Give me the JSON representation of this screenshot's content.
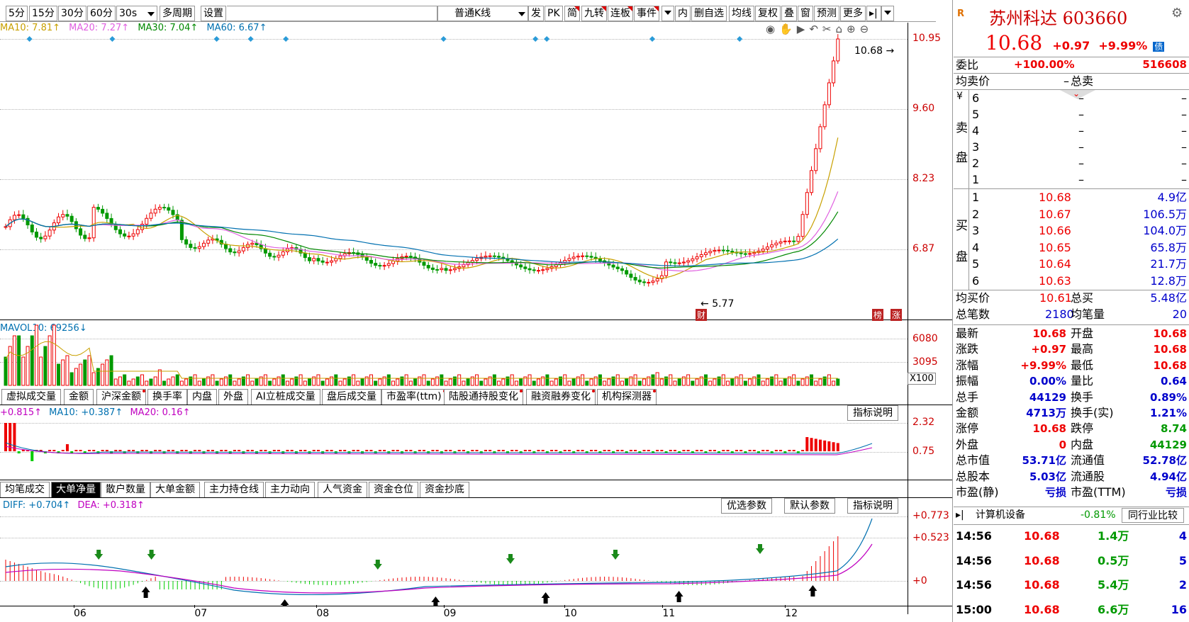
{
  "toolbar": {
    "periods": [
      "5分",
      "15分",
      "30分",
      "60分",
      "30s"
    ],
    "multi_period": "多周期",
    "settings": "设置",
    "kline_type": "普通K线",
    "tools": [
      "发",
      "PK",
      "简",
      "九转",
      "连板",
      "事件",
      "内",
      "删自选",
      "均线",
      "复权",
      "叠",
      "窗",
      "预测",
      "更多"
    ]
  },
  "ma_legend": [
    {
      "label": "MA10: 7.81↑",
      "color": "#c8a000"
    },
    {
      "label": "MA20: 7.27↑",
      "color": "#e060e0"
    },
    {
      "label": "MA30: 7.04↑",
      "color": "#008800"
    },
    {
      "label": "MA60: 6.67↑",
      "color": "#0070b0"
    }
  ],
  "price_axis": [
    "10.95",
    "9.60",
    "8.23",
    "6.87"
  ],
  "price_marker": "10.68",
  "low_marker": "5.77",
  "low_badge": "财",
  "badges": [
    "榜",
    "涨"
  ],
  "volume": {
    "legend": "MAVOL10: 69256↓",
    "axis": [
      "6080",
      "3095"
    ],
    "unit": "X100"
  },
  "vol_tabs": [
    {
      "label": "虚拟成交量",
      "flag": false
    },
    {
      "label": "金额",
      "flag": false
    },
    {
      "label": "沪深金额",
      "flag": true
    },
    {
      "label": "换手率",
      "flag": false
    },
    {
      "label": "内盘",
      "flag": false
    },
    {
      "label": "外盘",
      "flag": false
    },
    {
      "label": "AI立桩成交量",
      "flag": false
    },
    {
      "label": "盘后成交量",
      "flag": false
    },
    {
      "label": "市盈率(ttm)",
      "flag": true
    },
    {
      "label": "陆股通持股变化",
      "flag": true
    },
    {
      "label": "融资融券变化",
      "flag": true
    },
    {
      "label": "机构探测器",
      "flag": true
    }
  ],
  "ind1": {
    "legend": [
      {
        "label": "+0.815↑",
        "color": "#c000c0"
      },
      {
        "label": "MA10: +0.387↑",
        "color": "#0070b0"
      },
      {
        "label": "MA20: 0.16↑",
        "color": "#c000c0"
      }
    ],
    "axis": [
      "2.32",
      "0.75"
    ],
    "explain": "指标说明"
  },
  "ind1_tabs": [
    "均笔成交",
    "大单净量",
    "散户数量",
    "大单金额",
    "主力持仓线",
    "主力动向",
    "人气资金",
    "资金仓位",
    "资金抄底"
  ],
  "macd": {
    "diff": "DIFF: +0.704↑",
    "dea": "DEA: +0.318↑",
    "axis": [
      "+0.773",
      "+0.523",
      "+0"
    ],
    "buttons": [
      "优选参数",
      "默认参数",
      "指标说明"
    ]
  },
  "date_axis": [
    "06",
    "07",
    "08",
    "09",
    "10",
    "11",
    "12"
  ],
  "quote": {
    "name": "苏州科达",
    "code": "603660",
    "price": "10.68",
    "change": "+0.97",
    "pct": "+9.99%",
    "badge": "债",
    "r_badge": "R",
    "weibi_label": "委比",
    "weibi_value": "+100.00%",
    "weicha": "516608",
    "avg_sell_label": "均卖价",
    "avg_sell_value": "–",
    "total_sell_label": "总卖",
    "total_sell_value": "",
    "sell_side_label": [
      "卖",
      "盘"
    ],
    "sell_currency": "¥",
    "sells": [
      {
        "lvl": "6",
        "price": "–",
        "vol": "–"
      },
      {
        "lvl": "5",
        "price": "–",
        "vol": "–"
      },
      {
        "lvl": "4",
        "price": "–",
        "vol": "–"
      },
      {
        "lvl": "3",
        "price": "–",
        "vol": "–"
      },
      {
        "lvl": "2",
        "price": "–",
        "vol": "–"
      },
      {
        "lvl": "1",
        "price": "–",
        "vol": "–"
      }
    ],
    "buy_side_label": [
      "买",
      "盘"
    ],
    "buys": [
      {
        "lvl": "1",
        "price": "10.68",
        "vol": "4.9亿"
      },
      {
        "lvl": "2",
        "price": "10.67",
        "vol": "106.5万"
      },
      {
        "lvl": "3",
        "price": "10.66",
        "vol": "104.0万"
      },
      {
        "lvl": "4",
        "price": "10.65",
        "vol": "65.8万"
      },
      {
        "lvl": "5",
        "price": "10.64",
        "vol": "21.7万"
      },
      {
        "lvl": "6",
        "price": "10.63",
        "vol": "12.8万"
      }
    ],
    "avg_buy_label": "均买价",
    "avg_buy_value": "10.61",
    "total_buy_label": "总买",
    "total_buy_value": "5.48亿",
    "total_trades_label": "总笔数",
    "total_trades_value": "2180",
    "avg_vol_label": "均笔量",
    "avg_vol_value": "20",
    "stats": [
      {
        "l": "最新",
        "lv": "10.68",
        "lc": "#e00",
        "r": "开盘",
        "rv": "10.68",
        "rc": "#e00"
      },
      {
        "l": "涨跌",
        "lv": "+0.97",
        "lc": "#e00",
        "r": "最高",
        "rv": "10.68",
        "rc": "#e00"
      },
      {
        "l": "涨幅",
        "lv": "+9.99%",
        "lc": "#e00",
        "r": "最低",
        "rv": "10.68",
        "rc": "#e00"
      },
      {
        "l": "振幅",
        "lv": "0.00%",
        "lc": "#00c",
        "r": "量比",
        "rv": "0.64",
        "rc": "#00c"
      },
      {
        "l": "总手",
        "lv": "44129",
        "lc": "#00c",
        "r": "换手",
        "rv": "0.89%",
        "rc": "#00c"
      },
      {
        "l": "金额",
        "lv": "4713万",
        "lc": "#00c",
        "r": "换手(实)",
        "rv": "1.21%",
        "rc": "#00c"
      },
      {
        "l": "涨停",
        "lv": "10.68",
        "lc": "#e00",
        "r": "跌停",
        "rv": "8.74",
        "rc": "#090"
      },
      {
        "l": "外盘",
        "lv": "0",
        "lc": "#e00",
        "r": "内盘",
        "rv": "44129",
        "rc": "#090"
      },
      {
        "l": "总市值",
        "lv": "53.71亿",
        "lc": "#00c",
        "r": "流通值",
        "rv": "52.78亿",
        "rc": "#00c"
      },
      {
        "l": "总股本",
        "lv": "5.03亿",
        "lc": "#00c",
        "r": "流通股",
        "rv": "4.94亿",
        "rc": "#00c"
      },
      {
        "l": "市盈(静)",
        "lv": "亏损",
        "lc": "#00c",
        "r": "市盈(TTM)",
        "rv": "亏损",
        "rc": "#00c"
      }
    ],
    "sector_name": "计算机设备",
    "sector_pct": "-0.81%",
    "sector_btn": "同行业比较",
    "ticks": [
      {
        "time": "14:56",
        "price": "10.68",
        "vol": "1.4万",
        "n": "4"
      },
      {
        "time": "14:56",
        "price": "10.68",
        "vol": "0.5万",
        "n": "5"
      },
      {
        "time": "14:56",
        "price": "10.68",
        "vol": "5.4万",
        "n": "2"
      },
      {
        "time": "15:00",
        "price": "10.68",
        "vol": "6.6万",
        "n": "16"
      }
    ]
  }
}
